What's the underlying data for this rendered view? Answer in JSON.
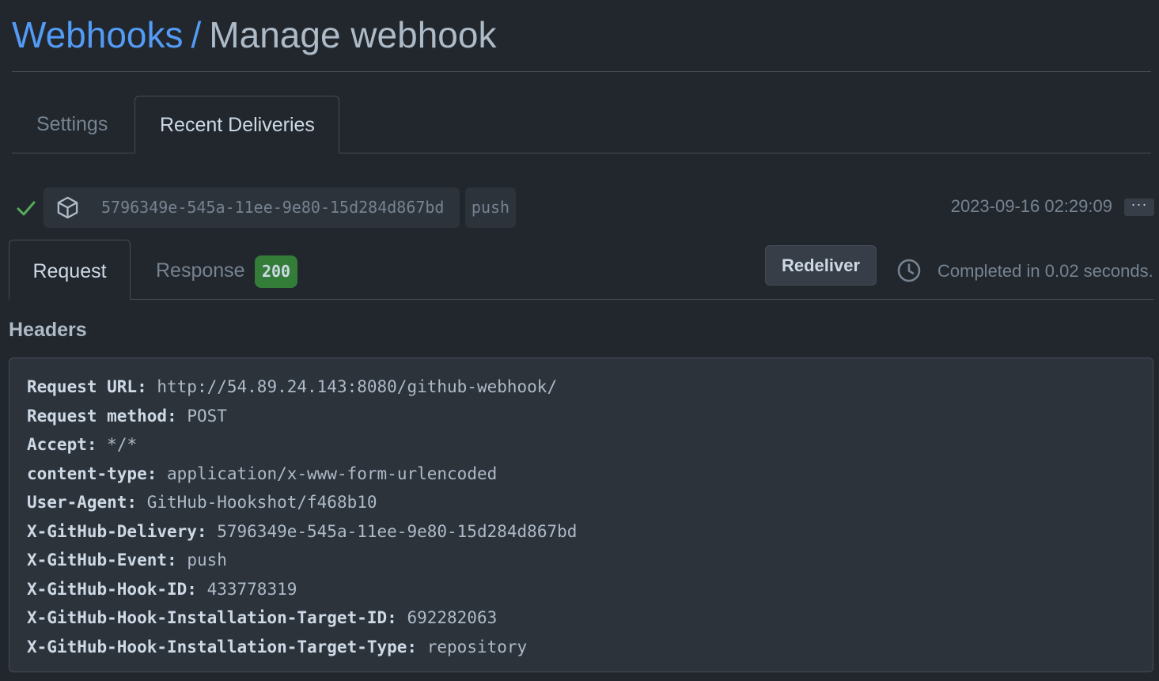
{
  "breadcrumb": {
    "parent": "Webhooks",
    "separator": "/",
    "current": "Manage webhook"
  },
  "top_tabs": {
    "settings": "Settings",
    "recent_deliveries": "Recent Deliveries",
    "active": "Recent Deliveries"
  },
  "delivery": {
    "status_icon": "check-icon",
    "id": "5796349e-545a-11ee-9e80-15d284d867bd",
    "event": "push",
    "timestamp": "2023-09-16 02:29:09",
    "more_label": "···"
  },
  "detail_tabs": {
    "request": "Request",
    "response": "Response",
    "response_status": "200",
    "active": "Request"
  },
  "actions": {
    "redeliver": "Redeliver",
    "completed": "Completed in 0.02 seconds."
  },
  "headers": {
    "title": "Headers",
    "items": [
      {
        "key": "Request URL:",
        "value": "http://54.89.24.143:8080/github-webhook/"
      },
      {
        "key": "Request method:",
        "value": "POST"
      },
      {
        "key": "Accept:",
        "value": "*/*"
      },
      {
        "key": "content-type:",
        "value": "application/x-www-form-urlencoded"
      },
      {
        "key": "User-Agent:",
        "value": "GitHub-Hookshot/f468b10"
      },
      {
        "key": "X-GitHub-Delivery:",
        "value": "5796349e-545a-11ee-9e80-15d284d867bd"
      },
      {
        "key": "X-GitHub-Event:",
        "value": "push"
      },
      {
        "key": "X-GitHub-Hook-ID:",
        "value": "433778319"
      },
      {
        "key": "X-GitHub-Hook-Installation-Target-ID:",
        "value": "692282063"
      },
      {
        "key": "X-GitHub-Hook-Installation-Target-Type:",
        "value": "repository"
      }
    ]
  },
  "colors": {
    "background": "#22272e",
    "link": "#539bf5",
    "success": "#57ab5a",
    "badge_green": "#347d39"
  }
}
